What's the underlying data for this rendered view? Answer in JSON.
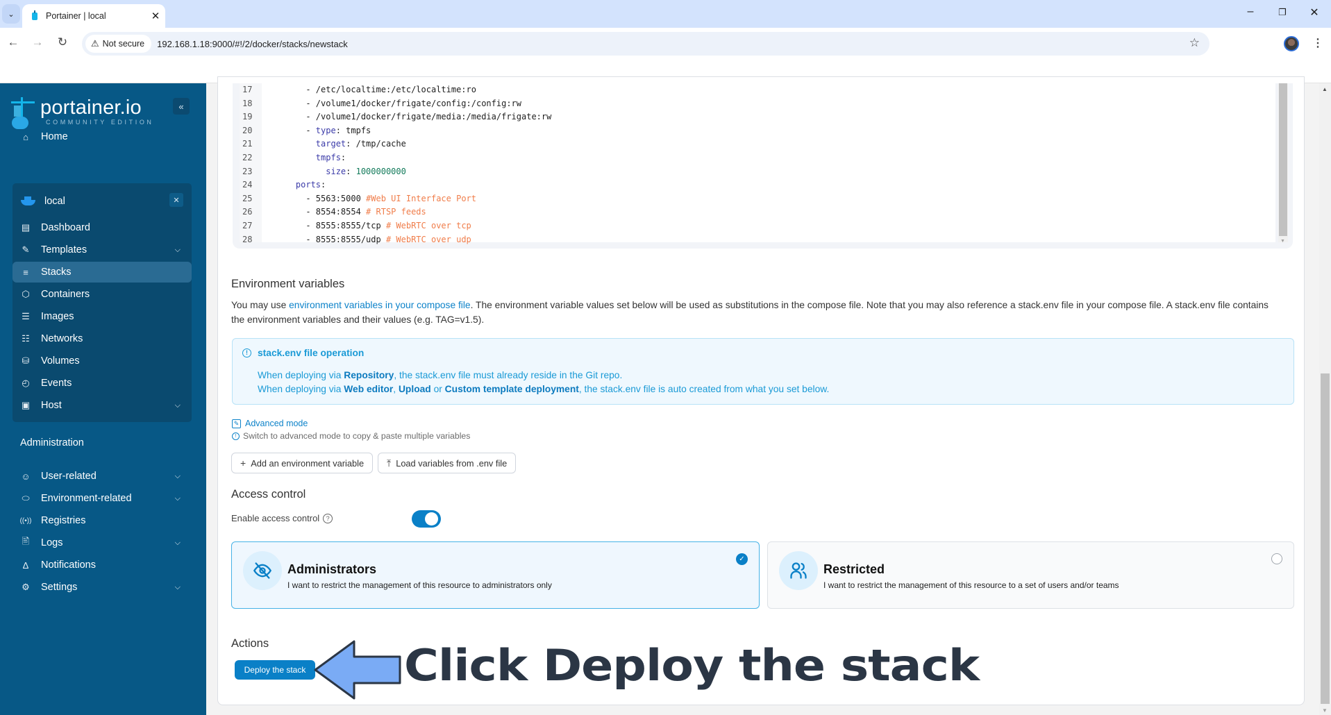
{
  "browser": {
    "tab_title": "Portainer | local",
    "security_label": "Not secure",
    "url": "192.168.1.18:9000/#!/2/docker/stacks/newstack"
  },
  "sidebar": {
    "logo_name": "portainer.io",
    "logo_edition": "COMMUNITY EDITION",
    "home": "Home",
    "environment": {
      "name": "local"
    },
    "env_items": [
      {
        "label": "Dashboard",
        "icon": "dashboard-icon"
      },
      {
        "label": "Templates",
        "icon": "edit-icon",
        "expandable": true
      },
      {
        "label": "Stacks",
        "icon": "layers-icon",
        "active": true
      },
      {
        "label": "Containers",
        "icon": "box-icon"
      },
      {
        "label": "Images",
        "icon": "list-icon"
      },
      {
        "label": "Networks",
        "icon": "network-icon"
      },
      {
        "label": "Volumes",
        "icon": "database-icon"
      },
      {
        "label": "Events",
        "icon": "clock-icon"
      },
      {
        "label": "Host",
        "icon": "host-icon",
        "expandable": true
      }
    ],
    "admin_heading": "Administration",
    "admin_items": [
      {
        "label": "User-related",
        "icon": "users-icon",
        "expandable": true
      },
      {
        "label": "Environment-related",
        "icon": "hard-drive-icon",
        "expandable": true
      },
      {
        "label": "Registries",
        "icon": "radio-icon"
      },
      {
        "label": "Logs",
        "icon": "file-text-icon",
        "expandable": true
      },
      {
        "label": "Notifications",
        "icon": "bell-icon"
      },
      {
        "label": "Settings",
        "icon": "gear-icon",
        "expandable": true
      }
    ]
  },
  "editor": {
    "lines": [
      {
        "n": "17",
        "parts": [
          [
            "",
            "      - /etc/localtime:/etc/localtime:ro"
          ]
        ]
      },
      {
        "n": "18",
        "parts": [
          [
            "",
            "      - /volume1/docker/frigate/config:/config:rw"
          ]
        ]
      },
      {
        "n": "19",
        "parts": [
          [
            "",
            "      - /volume1/docker/frigate/media:/media/frigate:rw"
          ]
        ]
      },
      {
        "n": "20",
        "parts": [
          [
            "",
            "      - "
          ],
          [
            "k",
            "type"
          ],
          [
            "",
            ": tmpfs"
          ]
        ]
      },
      {
        "n": "21",
        "parts": [
          [
            "",
            "        "
          ],
          [
            "k",
            "target"
          ],
          [
            "",
            ": /tmp/cache"
          ]
        ]
      },
      {
        "n": "22",
        "parts": [
          [
            "",
            "        "
          ],
          [
            "k",
            "tmpfs"
          ],
          [
            "",
            ":"
          ]
        ]
      },
      {
        "n": "23",
        "parts": [
          [
            "",
            "          "
          ],
          [
            "k",
            "size"
          ],
          [
            "",
            ": "
          ],
          [
            "n",
            "1000000000"
          ]
        ]
      },
      {
        "n": "24",
        "parts": [
          [
            "",
            "    "
          ],
          [
            "k",
            "ports"
          ],
          [
            "",
            ":"
          ]
        ]
      },
      {
        "n": "25",
        "parts": [
          [
            "",
            "      - 5563:5000 "
          ],
          [
            "c",
            "#Web UI Interface Port"
          ]
        ]
      },
      {
        "n": "26",
        "parts": [
          [
            "",
            "      - 8554:8554 "
          ],
          [
            "c",
            "# RTSP feeds"
          ]
        ]
      },
      {
        "n": "27",
        "parts": [
          [
            "",
            "      - 8555:8555/tcp "
          ],
          [
            "c",
            "# WebRTC over tcp"
          ]
        ]
      },
      {
        "n": "28",
        "parts": [
          [
            "",
            "      - 8555:8555/udp "
          ],
          [
            "c",
            "# WebRTC over udp"
          ]
        ]
      }
    ]
  },
  "env_vars": {
    "heading": "Environment variables",
    "desc_prefix": "You may use ",
    "desc_link": "environment variables in your compose file",
    "desc_suffix": ". The environment variable values set below will be used as substitutions in the compose file. Note that you may also reference a stack.env file in your compose file. A stack.env file contains the environment variables and their values (e.g. TAG=v1.5).",
    "callout": {
      "title": "stack.env file operation",
      "line1_a": "When deploying via ",
      "line1_b": "Repository",
      "line1_c": ", the stack.env file must already reside in the Git repo.",
      "line2_a": "When deploying via ",
      "line2_b": "Web editor",
      "line2_c": ", ",
      "line2_d": "Upload",
      "line2_e": " or ",
      "line2_f": "Custom template deployment",
      "line2_g": ", the stack.env file is auto created from what you set below."
    },
    "advanced_mode": "Advanced mode",
    "advanced_hint": "Switch to advanced mode to copy & paste multiple variables",
    "add_button": "Add an environment variable",
    "load_button": "Load variables from .env file"
  },
  "access_control": {
    "heading": "Access control",
    "toggle_label": "Enable access control",
    "enabled": true,
    "options": [
      {
        "title": "Administrators",
        "desc": "I want to restrict the management of this resource to administrators only",
        "selected": true
      },
      {
        "title": "Restricted",
        "desc": "I want to restrict the management of this resource to a set of users and/or teams",
        "selected": false
      }
    ]
  },
  "actions": {
    "heading": "Actions",
    "deploy_button": "Deploy the stack"
  },
  "annotation": {
    "text": "Click Deploy the stack",
    "arrow_color": "#7aabf5"
  }
}
